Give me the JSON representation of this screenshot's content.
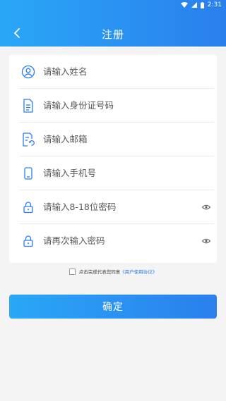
{
  "status_bar": {
    "time": "2:31"
  },
  "header": {
    "title": "注册",
    "back_icon": "back-arrow-icon"
  },
  "form": {
    "name_placeholder": "请输入姓名",
    "id_placeholder": "请输入身份证号码",
    "email_placeholder": "请输入邮箱",
    "phone_placeholder": "请输入手机号",
    "password_placeholder": "请输入8-18位密码",
    "confirm_password_placeholder": "请再次输入密码"
  },
  "agreement": {
    "text": "点击完成代表您同意",
    "link": "《用户使用协议》"
  },
  "confirm_label": "确定",
  "colors": {
    "accent": "#2a7fed",
    "accent_light": "#2aa7f7",
    "background": "#f4f4f5"
  }
}
